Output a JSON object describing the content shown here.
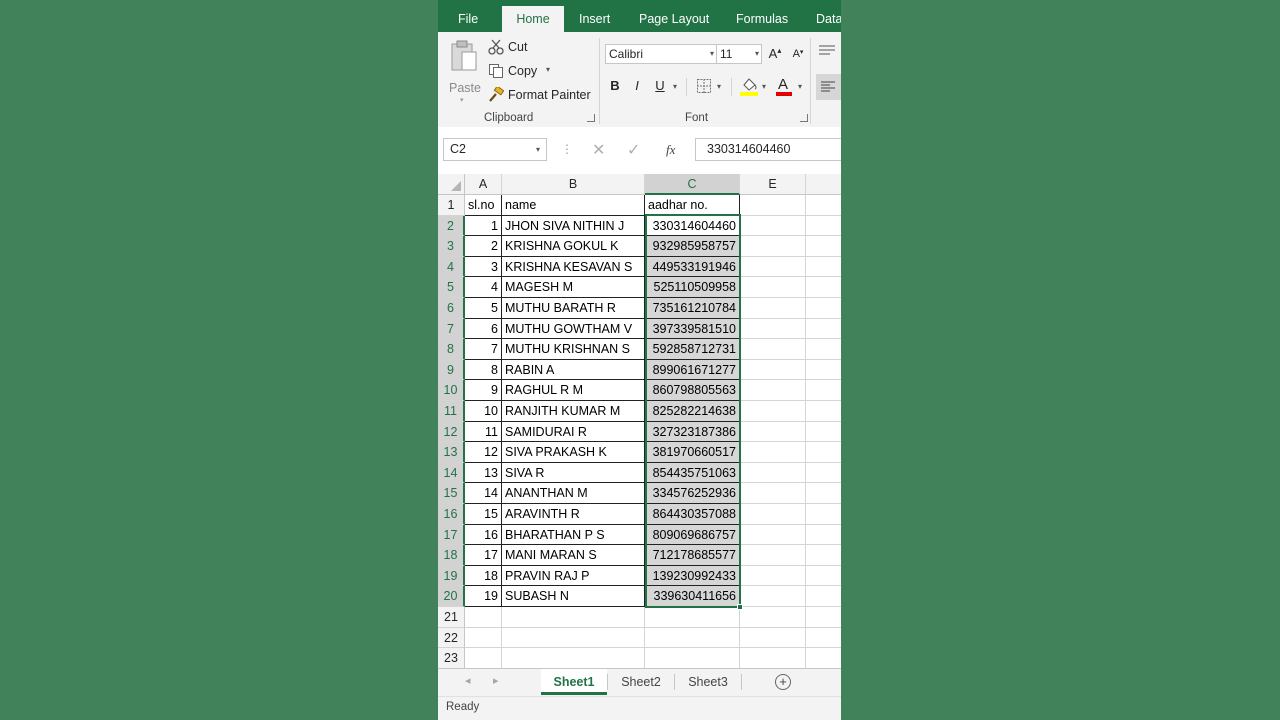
{
  "ribbon": {
    "tabs": [
      {
        "label": "File",
        "active": false
      },
      {
        "label": "Home",
        "active": true
      },
      {
        "label": "Insert",
        "active": false
      },
      {
        "label": "Page Layout",
        "active": false
      },
      {
        "label": "Formulas",
        "active": false
      },
      {
        "label": "Data",
        "active": false
      }
    ],
    "clipboard": {
      "paste_label": "Paste",
      "cut_label": "Cut",
      "copy_label": "Copy",
      "format_painter_label": "Format Painter",
      "group_label": "Clipboard"
    },
    "font": {
      "font_name": "Calibri",
      "font_size": "11",
      "grow_label": "A",
      "shrink_label": "A",
      "bold_label": "B",
      "italic_label": "I",
      "underline_label": "U",
      "font_color_label": "A",
      "group_label": "Font"
    }
  },
  "formula_bar": {
    "name_box": "C2",
    "fx_label": "fx",
    "value": "330314604460"
  },
  "sheet": {
    "columns": [
      "A",
      "B",
      "C",
      "E"
    ],
    "headers": [
      "sl.no",
      "name",
      "aadhar no."
    ],
    "rows": [
      {
        "n": "2",
        "sl": "1",
        "name": "JHON SIVA NITHIN J",
        "aadhar": "330314604460"
      },
      {
        "n": "3",
        "sl": "2",
        "name": "KRISHNA GOKUL K",
        "aadhar": "932985958757"
      },
      {
        "n": "4",
        "sl": "3",
        "name": "KRISHNA KESAVAN S",
        "aadhar": "449533191946"
      },
      {
        "n": "5",
        "sl": "4",
        "name": "MAGESH M",
        "aadhar": "525110509958"
      },
      {
        "n": "6",
        "sl": "5",
        "name": "MUTHU BARATH R",
        "aadhar": "735161210784"
      },
      {
        "n": "7",
        "sl": "6",
        "name": "MUTHU GOWTHAM V",
        "aadhar": "397339581510"
      },
      {
        "n": "8",
        "sl": "7",
        "name": "MUTHU KRISHNAN S",
        "aadhar": "592858712731"
      },
      {
        "n": "9",
        "sl": "8",
        "name": "RABIN A",
        "aadhar": "899061671277"
      },
      {
        "n": "10",
        "sl": "9",
        "name": "RAGHUL R M",
        "aadhar": "860798805563"
      },
      {
        "n": "11",
        "sl": "10",
        "name": "RANJITH KUMAR M",
        "aadhar": "825282214638"
      },
      {
        "n": "12",
        "sl": "11",
        "name": "SAMIDURAI R",
        "aadhar": "327323187386"
      },
      {
        "n": "13",
        "sl": "12",
        "name": "SIVA PRAKASH K",
        "aadhar": "381970660517"
      },
      {
        "n": "14",
        "sl": "13",
        "name": "SIVA R",
        "aadhar": "854435751063"
      },
      {
        "n": "15",
        "sl": "14",
        "name": "ANANTHAN M",
        "aadhar": "334576252936"
      },
      {
        "n": "16",
        "sl": "15",
        "name": "ARAVINTH R",
        "aadhar": "864430357088"
      },
      {
        "n": "17",
        "sl": "16",
        "name": "BHARATHAN P S",
        "aadhar": "809069686757"
      },
      {
        "n": "18",
        "sl": "17",
        "name": "MANI MARAN S",
        "aadhar": "712178685577"
      },
      {
        "n": "19",
        "sl": "18",
        "name": "PRAVIN RAJ P",
        "aadhar": "139230992433"
      },
      {
        "n": "20",
        "sl": "19",
        "name": "SUBASH N",
        "aadhar": "339630411656"
      }
    ],
    "empty_rows": [
      "21",
      "22",
      "23"
    ],
    "header_row": "1"
  },
  "sheet_tabs": [
    {
      "label": "Sheet1",
      "active": true
    },
    {
      "label": "Sheet2",
      "active": false
    },
    {
      "label": "Sheet3",
      "active": false
    }
  ],
  "status": "Ready",
  "colors": {
    "accent": "#217346",
    "background": "#42825a"
  }
}
